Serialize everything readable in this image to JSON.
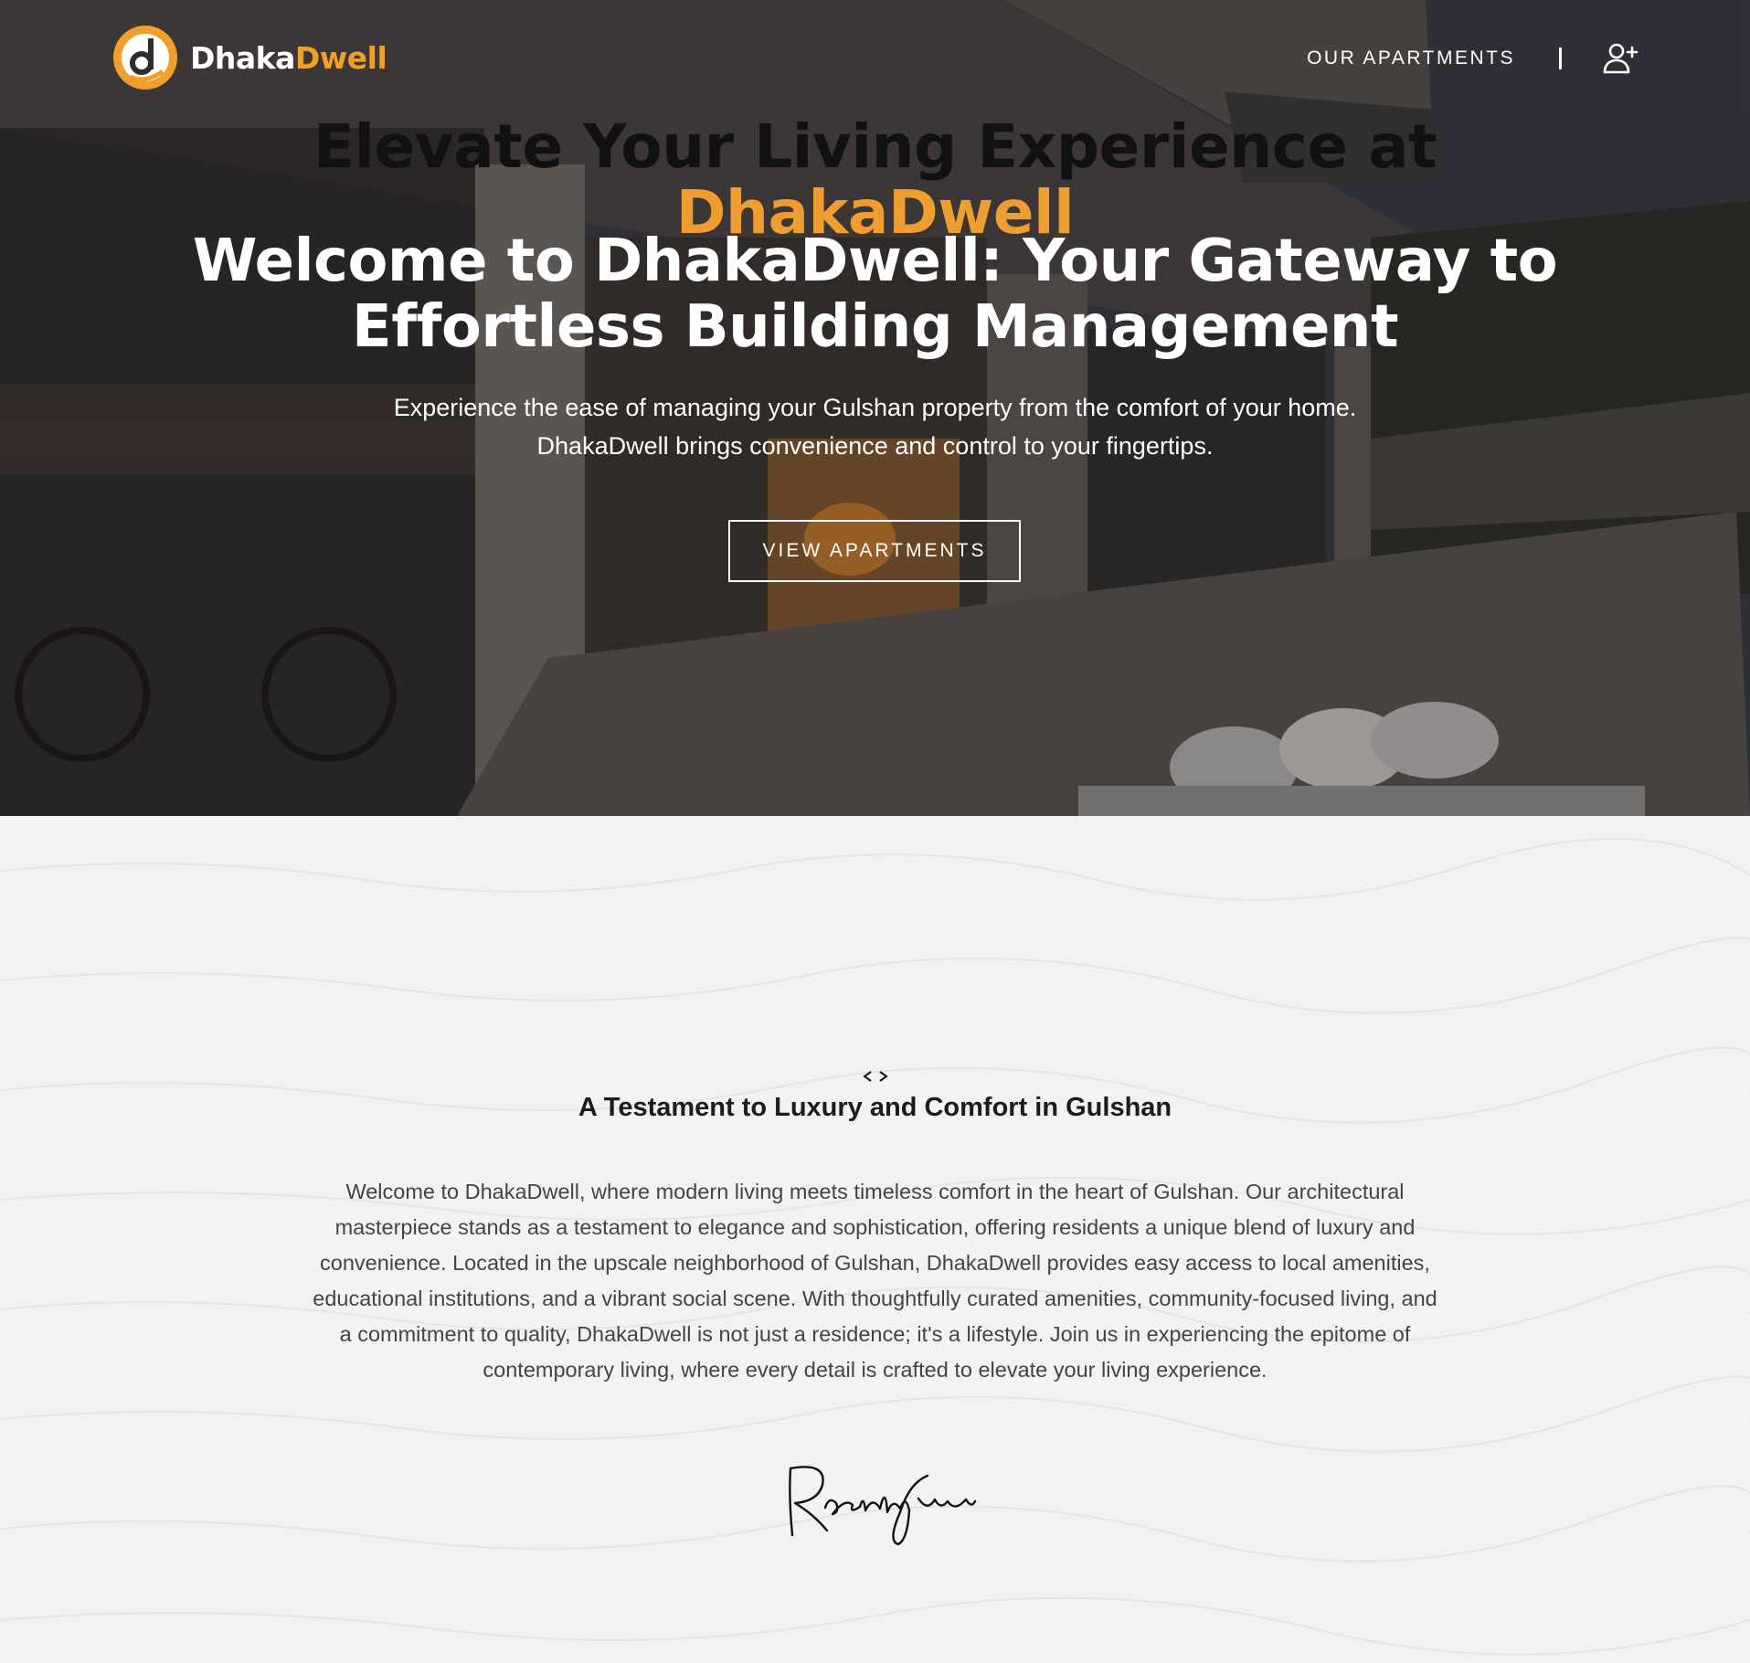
{
  "brand": {
    "name_part1": "Dhaka",
    "name_part2": "Dwell",
    "accent_color": "#f0a02a"
  },
  "nav": {
    "apartments_link": "OUR APARTMENTS",
    "user_icon": "user-plus-icon"
  },
  "hero": {
    "title": "Welcome to DhakaDwell: Your Gateway to Effortless Building Management",
    "subtitle_line1": "Experience the ease of managing your Gulshan property from the comfort of your home.",
    "subtitle_line2": "DhakaDwell brings convenience and control to your fingertips.",
    "button_label": "VIEW APARTMENTS"
  },
  "about": {
    "title_line1": "Elevate Your Living Experience at",
    "title_accent": "DhakaDwell",
    "divider_icon": "code-brackets-icon",
    "subtitle": "A Testament to Luxury and Comfort in Gulshan",
    "body": "Welcome to DhakaDwell, where modern living meets timeless comfort in the heart of Gulshan. Our architectural masterpiece stands as a testament to elegance and sophistication, offering residents a unique blend of luxury and convenience. Located in the upscale neighborhood of Gulshan, DhakaDwell provides easy access to local amenities, educational institutions, and a vibrant social scene. With thoughtfully curated amenities, community-focused living, and a commitment to quality, DhakaDwell is not just a residence; it's a lifestyle. Join us in experiencing the epitome of contemporary living, where every detail is crafted to elevate your living experience.",
    "accent_color": "#ee9d33"
  }
}
